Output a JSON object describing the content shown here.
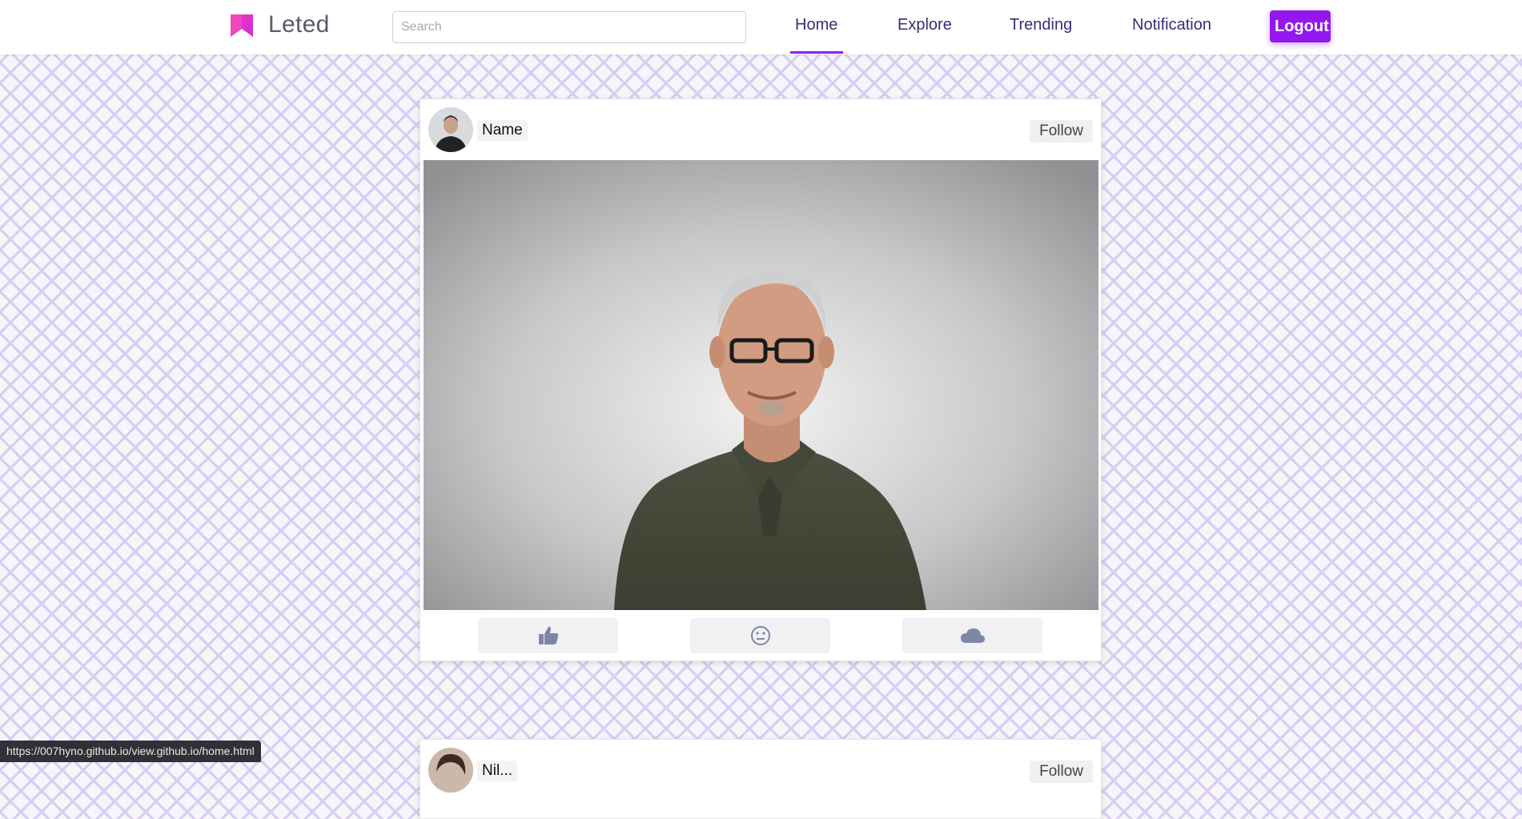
{
  "app": {
    "name": "Leted",
    "brand_color": "#e430c9",
    "accent": "#9417f0"
  },
  "search": {
    "placeholder": "Search",
    "value": ""
  },
  "nav": {
    "home": "Home",
    "explore": "Explore",
    "trending": "Trending",
    "notification": "Notification",
    "logout": "Logout",
    "active": "Home"
  },
  "posts": [
    {
      "name": "Name",
      "follow_label": "Follow",
      "image_icon": "portrait-photo",
      "actions": [
        "thumbs-up-icon",
        "emoji-icon",
        "cloud-icon"
      ]
    },
    {
      "name": "Nil...",
      "follow_label": "Follow"
    }
  ],
  "status_bar": {
    "url": "https://007hyno.github.io/view.github.io/home.html"
  }
}
